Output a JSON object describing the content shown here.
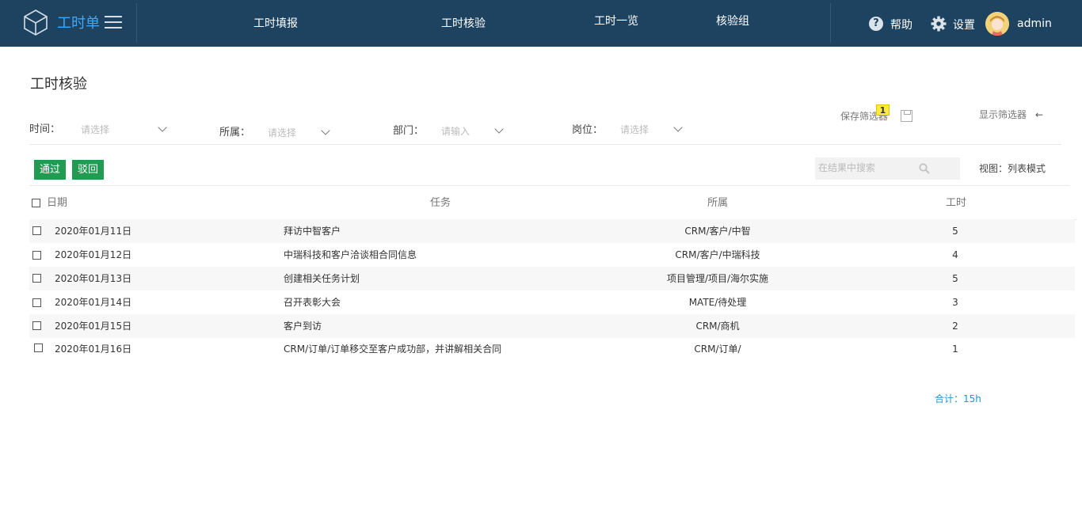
{
  "app": {
    "title": "工时单",
    "logo_icon": "cube-icon",
    "menu_icon": "hamburger-menu-icon"
  },
  "nav": {
    "items": [
      {
        "label": "工时填报"
      },
      {
        "label": "工时核验"
      },
      {
        "label": "工时一览"
      },
      {
        "label": "核验组"
      }
    ]
  },
  "header_right": {
    "help_label": "帮助",
    "settings_label": "设置",
    "username": "admin"
  },
  "page": {
    "title": "工时核验"
  },
  "filter_bar": {
    "save_filter_label": "保存筛选器",
    "save_filter_badge": "1",
    "show_filter_label": "显示筛选器",
    "show_filter_icon": "←",
    "filters": [
      {
        "label": "时间：",
        "placeholder": "请选择"
      },
      {
        "label": "所属：",
        "placeholder": "请选择"
      },
      {
        "label": "部门：",
        "placeholder": "请输入"
      },
      {
        "label": "岗位：",
        "placeholder": "请选择"
      }
    ]
  },
  "toolbar": {
    "approve_label": "通过",
    "reject_label": "驳回",
    "search_placeholder": "在结果中搜索",
    "view_mode_label": "视图：列表模式"
  },
  "table": {
    "headers": {
      "date": "日期",
      "task": "任务",
      "project": "所属",
      "hours": "工时"
    },
    "rows": [
      {
        "date": "2020年01月11日",
        "task": "拜访中智客户",
        "project": "CRM/客户/中智",
        "hours": "5"
      },
      {
        "date": "2020年01月12日",
        "task": "中瑞科技和客户洽谈相合同信息",
        "project": "CRM/客户/中瑞科技",
        "hours": "4"
      },
      {
        "date": "2020年01月13日",
        "task": "创建相关任务计划",
        "project": "项目管理/项目/海尔实施",
        "hours": "5"
      },
      {
        "date": "2020年01月14日",
        "task": "召开表彰大会",
        "project": "MATE/待处理",
        "hours": "3"
      },
      {
        "date": "2020年01月15日",
        "task": "客户到访",
        "project": "CRM/商机",
        "hours": "2"
      },
      {
        "date": "2020年01月16日",
        "task": "CRM/订单/订单移交至客户成功部，并讲解相关合同",
        "project": "CRM/订单/",
        "hours": "1"
      }
    ]
  },
  "summary": {
    "total_label": "合计：15h"
  },
  "colors": {
    "header_bg": "#1e4361",
    "accent_blue": "#42a5f5",
    "button_green": "#1f9b52",
    "total_text": "#2196d3",
    "badge_yellow": "#ffeb3b"
  }
}
